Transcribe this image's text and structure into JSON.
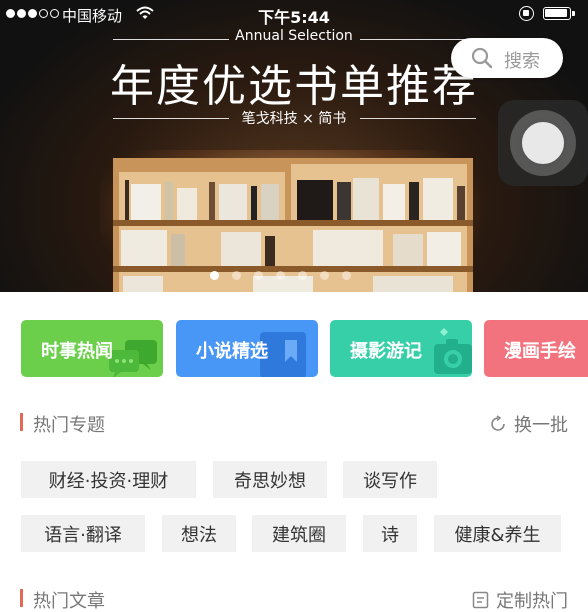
{
  "status_bar": {
    "carrier": "中国移动",
    "time": "下午5:44"
  },
  "banner": {
    "subtitle_en": "Annual Selection",
    "title": "年度优选书单推荐",
    "collab": "笔戈科技 × 简书",
    "dots_total": 7,
    "dots_active_index": 0
  },
  "search": {
    "label": "搜索"
  },
  "categories": [
    {
      "label": "时事热闻",
      "color": "#6bcf4c",
      "icon": "chat-bubbles-icon"
    },
    {
      "label": "小说精选",
      "color": "#4896f5",
      "icon": "bookmark-icon"
    },
    {
      "label": "摄影游记",
      "color": "#36cfa8",
      "icon": "camera-icon"
    },
    {
      "label": "漫画手绘",
      "color": "#f2737e",
      "icon": "drawing-icon"
    }
  ],
  "hot_topics": {
    "title": "热门专题",
    "action": "换一批",
    "tags": [
      "财经·投资·理财",
      "奇思妙想",
      "谈写作",
      "语言·翻译",
      "想法",
      "建筑圈",
      "诗",
      "健康&养生"
    ]
  },
  "hot_articles": {
    "title": "热门文章",
    "action": "定制热门"
  },
  "colors": {
    "section_accent": "#e36a55",
    "tag_bg": "#f1f1f1"
  }
}
